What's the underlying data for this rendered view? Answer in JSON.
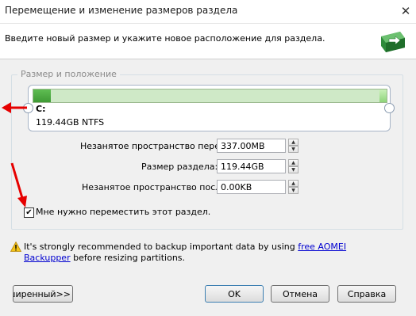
{
  "window": {
    "title": "Перемещение и изменение размеров раздела",
    "close_glyph": "✕"
  },
  "header": {
    "instruction": "Введите новый размер и укажите новое расположение для раздела."
  },
  "group": {
    "legend": "Размер и положение"
  },
  "partition": {
    "letter": "C:",
    "info": "119.44GB NTFS",
    "used_fraction": 0.05,
    "free_fraction": 0.02,
    "colors": {
      "used": "#3f9a35",
      "track": "#cfe9c7"
    }
  },
  "fields": {
    "unallocated_before_label": "Незанятое пространство перед:",
    "unallocated_before_value": "337.00MB",
    "partition_size_label": "Размер раздела:",
    "partition_size_value": "119.44GB",
    "unallocated_after_label": "Незанятое пространство после:",
    "unallocated_after_value": "0.00KB"
  },
  "move_checkbox": {
    "label": "Мне нужно переместить этот раздел.",
    "checked": true,
    "check_glyph": "✔"
  },
  "warning": {
    "text_before": "It's strongly recommended to backup important data by using ",
    "link": "free AOMEI Backupper",
    "text_after": " before resizing partitions."
  },
  "buttons": {
    "advanced": "асширенный>>",
    "ok": "OK",
    "cancel": "Отмена",
    "help": "Справка"
  },
  "spin_glyphs": {
    "up": "▲",
    "down": "▼"
  },
  "annotation_color": "#e60000"
}
